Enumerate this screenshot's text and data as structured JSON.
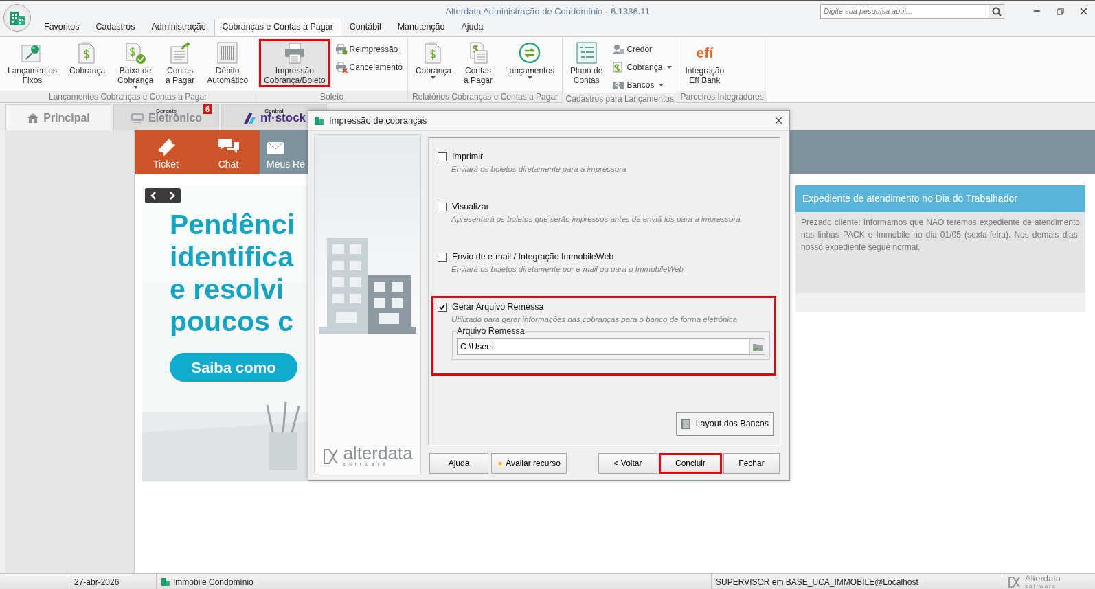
{
  "window": {
    "title": "Alterdata Administração de Condomínio - 6.1336.11"
  },
  "search": {
    "placeholder": "Digite sua pesquisa aqui..."
  },
  "menu_tabs": [
    {
      "label": "Favoritos",
      "selected": false
    },
    {
      "label": "Cadastros",
      "selected": false
    },
    {
      "label": "Administração",
      "selected": false
    },
    {
      "label": "Cobranças e Contas a Pagar",
      "selected": true
    },
    {
      "label": "Contábil",
      "selected": false
    },
    {
      "label": "Manutenção",
      "selected": false
    },
    {
      "label": "Ajuda",
      "selected": false
    }
  ],
  "ribbon_groups": [
    {
      "title": "Lançamentos Cobranças e Contas a Pagar",
      "items": [
        {
          "kind": "large",
          "label": "Lançamentos\nFixos",
          "dropdown": false,
          "highlighted": false
        },
        {
          "kind": "large",
          "label": "Cobrança",
          "dropdown": false,
          "highlighted": false
        },
        {
          "kind": "large",
          "label": "Baixa de\nCobrança",
          "dropdown": true,
          "highlighted": false
        },
        {
          "kind": "large",
          "label": "Contas\na Pagar",
          "dropdown": false,
          "highlighted": false
        },
        {
          "kind": "large",
          "label": "Débito\nAutomático",
          "dropdown": false,
          "highlighted": false
        }
      ]
    },
    {
      "title": "Boleto",
      "items": [
        {
          "kind": "large",
          "label": "Impressão\nCobrança/Boleto",
          "dropdown": false,
          "highlighted": true
        },
        {
          "kind": "small",
          "label": "Reimpressão",
          "dropdown": false,
          "highlighted": false
        },
        {
          "kind": "small",
          "label": "Cancelamento",
          "dropdown": false,
          "highlighted": false
        }
      ]
    },
    {
      "title": "Relatórios Cobranças e Contas a Pagar",
      "items": [
        {
          "kind": "large",
          "label": "Cobrança",
          "dropdown": true,
          "highlighted": false
        },
        {
          "kind": "large",
          "label": "Contas\na Pagar",
          "dropdown": false,
          "highlighted": false
        },
        {
          "kind": "large",
          "label": "Lançamentos",
          "dropdown": true,
          "highlighted": false
        }
      ]
    },
    {
      "title": "Cadastros para Lançamentos",
      "items": [
        {
          "kind": "large",
          "label": "Plano de\nContas",
          "dropdown": false,
          "highlighted": false
        },
        {
          "kind": "small",
          "label": "Credor",
          "dropdown": false,
          "highlighted": false
        },
        {
          "kind": "small",
          "label": "Cobrança",
          "dropdown": true,
          "highlighted": false
        },
        {
          "kind": "small",
          "label": "Bancos",
          "dropdown": true,
          "highlighted": false
        }
      ]
    },
    {
      "title": "Parceiros Integradores",
      "items": [
        {
          "kind": "large",
          "label": "Integração\nEfí Bank",
          "logo": "efí",
          "dropdown": false,
          "highlighted": false
        }
      ]
    }
  ],
  "doc_tabs": [
    {
      "label": "Principal",
      "selected": true
    },
    {
      "caption": "Gerente",
      "label": "Eletrônico",
      "badge": "6",
      "selected": false
    },
    {
      "caption": "Central",
      "label": "nf·stock",
      "selected": false
    }
  ],
  "quick_actions": [
    {
      "label": "Ticket",
      "color": "#cc5428"
    },
    {
      "label": "Chat",
      "color": "#cc5428"
    },
    {
      "label": "Meus Re",
      "color": "#7f939f"
    }
  ],
  "banner": {
    "lines": [
      "Pendênci",
      "identifica",
      "e resolvi",
      "poucos c"
    ],
    "button": "Saiba como"
  },
  "notice": {
    "title": "Expediente de atendimento no Dia do Trabalhador",
    "body": "Prezado cliente: Informamos que NÃO teremos expediente de atendimento nas linhas PACK e Immobile no dia 01/05 (sexta-feira). Nos demais dias, nosso expediente segue normal."
  },
  "dialog": {
    "title": "Impressão de cobranças",
    "options": [
      {
        "label": "Imprimir",
        "description": "Enviará os boletos diretamente para a impressora",
        "checked": false,
        "highlighted": false
      },
      {
        "label": "Visualizar",
        "description": "Apresentará os boletos que serão impressos antes de enviá-los para a impressora",
        "checked": false,
        "highlighted": false
      },
      {
        "label": "Envio de e-mail / Integração ImmobileWeb",
        "description": "Enviará os boletos diretamente por e-mail ou para o ImmobileWeb",
        "checked": false,
        "highlighted": false
      },
      {
        "label": "Gerar Arquivo Remessa",
        "description": "Utilizado para gerar informações das cobranças para o banco de forma eletrônica",
        "checked": true,
        "highlighted": true,
        "file": {
          "legend": "Arquivo Remessa",
          "value": "C:\\Users"
        }
      }
    ],
    "layout_button": "Layout dos Bancos",
    "logo": {
      "name": "alterdata",
      "tagline": "software"
    },
    "buttons": [
      {
        "label": "Ajuda",
        "highlighted": false
      },
      {
        "label": "Avaliar recurso",
        "highlighted": false
      },
      {
        "label": "< Voltar",
        "highlighted": false
      },
      {
        "label": "Concluir",
        "highlighted": true
      },
      {
        "label": "Fechar",
        "highlighted": false
      }
    ]
  },
  "status_bar": {
    "date": "27-abr-2026",
    "module": "Immobile Condomínio",
    "user": "SUPERVISOR em BASE_UCA_IMMOBILE@Localhost",
    "logo": "Alterdata",
    "tagline": "software"
  }
}
